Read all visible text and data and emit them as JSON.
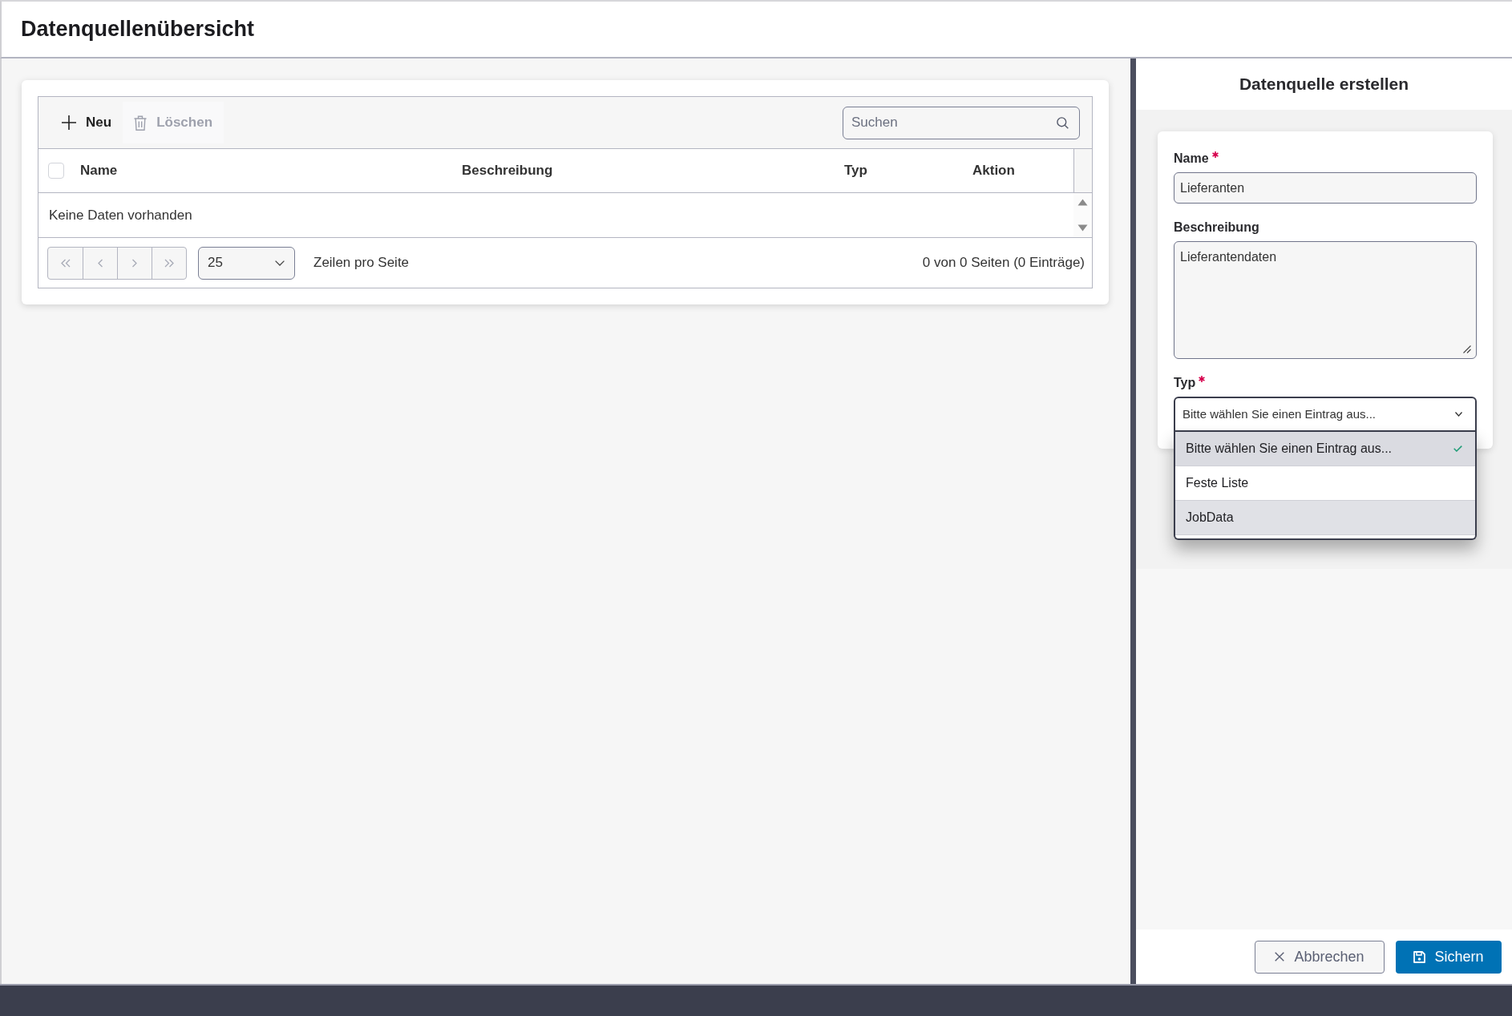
{
  "page": {
    "title": "Datenquellenübersicht"
  },
  "toolbar": {
    "buttons": [
      {
        "kind": "new",
        "label": "Neu",
        "disabled": false
      },
      {
        "kind": "delete",
        "label": "Löschen",
        "disabled": true
      }
    ],
    "search": {
      "placeholder": "Suchen"
    }
  },
  "table": {
    "select_all": {
      "checked": false
    },
    "columns": [
      "Name",
      "Beschreibung",
      "Typ",
      "Aktion"
    ],
    "empty_message": "Keine Daten vorhanden"
  },
  "pager": {
    "buttons": [
      {
        "kind": "first",
        "disabled": true
      },
      {
        "kind": "previous",
        "disabled": true
      },
      {
        "kind": "next",
        "disabled": true
      },
      {
        "kind": "last",
        "disabled": true
      }
    ],
    "page_size": "25",
    "page_size_label": "Zeilen pro Seite",
    "summary": "0 von 0 Seiten (0 Einträge)"
  },
  "panel": {
    "title": "Datenquelle erstellen",
    "fields": [
      {
        "kind": "text",
        "label": "Name",
        "required": true,
        "value": "Lieferanten"
      },
      {
        "kind": "textarea",
        "label": "Beschreibung",
        "required": false,
        "value": "Lieferantendaten"
      },
      {
        "kind": "select",
        "label": "Typ",
        "required": true,
        "value": "Bitte wählen Sie einen Eintrag aus...",
        "expanded": true,
        "options": [
          {
            "label": "Bitte wählen Sie einen Eintrag aus...",
            "selected": true,
            "hovered": false
          },
          {
            "label": "Feste Liste",
            "selected": false,
            "hovered": false
          },
          {
            "label": "JobData",
            "selected": false,
            "hovered": true
          }
        ]
      }
    ],
    "buttons": [
      {
        "kind": "cancel",
        "label": "Abbrechen"
      },
      {
        "kind": "save",
        "label": "Sichern"
      }
    ]
  }
}
